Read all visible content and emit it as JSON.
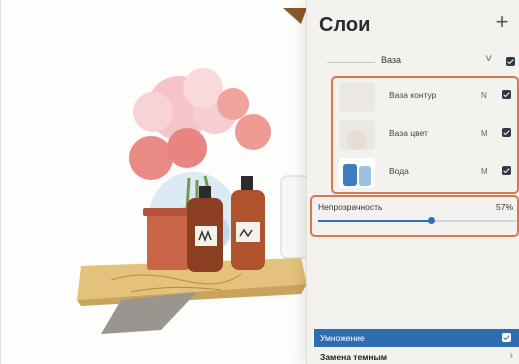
{
  "panel": {
    "title": "Слои",
    "add_icon": "plus-icon",
    "add_label": "+"
  },
  "group": {
    "name": "Ваза",
    "visible": true
  },
  "layers": [
    {
      "name": "Ваза контур",
      "blend": "N",
      "visible": true
    },
    {
      "name": "Ваза цвет",
      "blend": "M",
      "visible": true
    },
    {
      "name": "Вода",
      "blend": "M",
      "visible": true
    }
  ],
  "opacity": {
    "label": "Непрозрачность",
    "value_text": "57%",
    "value": 57
  },
  "blend_modes": {
    "selected": "Умножение",
    "next": "Замена темным"
  },
  "colors": {
    "accent": "#2e6fb5",
    "highlight": "#d8764e",
    "panel_bg": "#f4f2ee"
  }
}
